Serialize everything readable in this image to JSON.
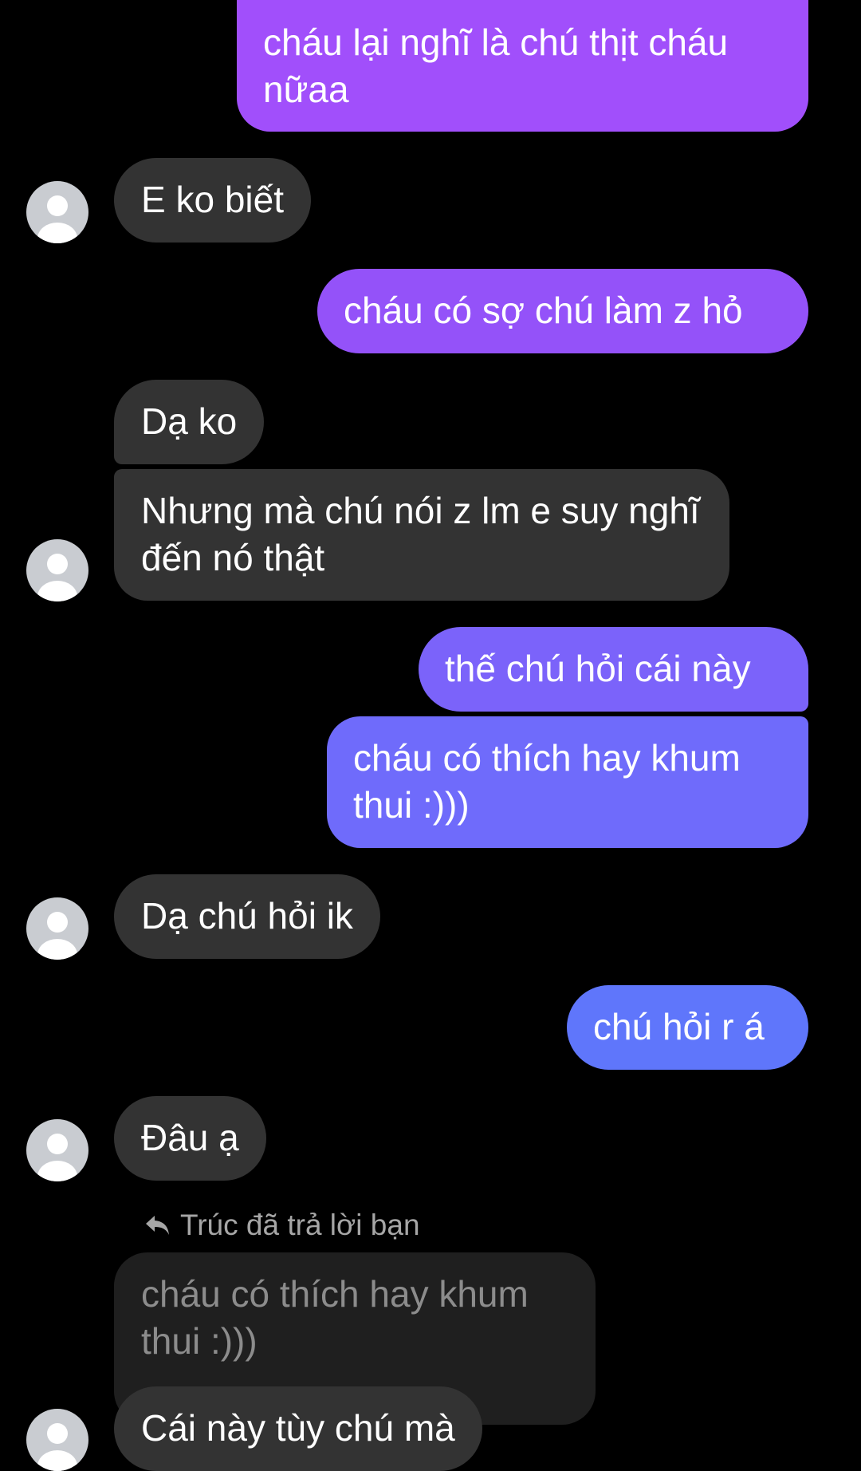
{
  "messages": [
    {
      "id": "m1",
      "side": "sent",
      "text": "cháu lại nghĩ là chú thịt cháu nữaa",
      "color": "#a14ffb"
    },
    {
      "id": "m2",
      "side": "received",
      "text": "E ko biết"
    },
    {
      "id": "m3",
      "side": "sent",
      "text": "cháu có sợ chú làm z hỏ",
      "color": "#9452f9"
    },
    {
      "id": "m4",
      "side": "received",
      "text": "Dạ ko"
    },
    {
      "id": "m5",
      "side": "received",
      "text": "Nhưng mà chú nói z lm e suy nghĩ đến nó thật"
    },
    {
      "id": "m6",
      "side": "sent",
      "text": "thế chú hỏi cái này",
      "color": "#7b63fa"
    },
    {
      "id": "m7",
      "side": "sent",
      "text": "cháu có thích hay khum thui :)))",
      "color": "#6f6bfb"
    },
    {
      "id": "m8",
      "side": "received",
      "text": "Dạ chú hỏi ik"
    },
    {
      "id": "m9",
      "side": "sent",
      "text": "chú hỏi r á",
      "color": "#5f76fb"
    },
    {
      "id": "m10",
      "side": "received",
      "text": "Đâu ạ"
    }
  ],
  "reply": {
    "label": "Trúc đã trả lời bạn",
    "quoted_text": "cháu có thích hay khum thui :)))",
    "text": "Cái này tùy chú mà"
  },
  "colors": {
    "background": "#000000",
    "received_bubble": "#333333",
    "quoted_bubble": "#1f1f1f",
    "avatar": "#c9ccd1"
  }
}
